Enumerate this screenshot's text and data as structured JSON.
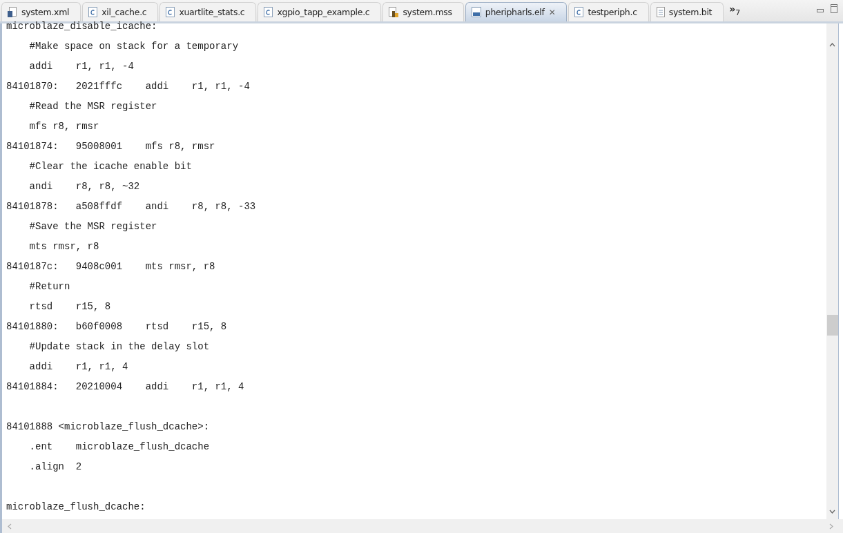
{
  "tabs": [
    {
      "label": "system.xml",
      "kind": "xml",
      "selected": false
    },
    {
      "label": "xil_cache.c",
      "kind": "c",
      "selected": false
    },
    {
      "label": "xuartlite_stats.c",
      "kind": "c",
      "selected": false
    },
    {
      "label": "xgpio_tapp_example.c",
      "kind": "c",
      "selected": false
    },
    {
      "label": "system.mss",
      "kind": "mss",
      "selected": false
    },
    {
      "label": "pheripharls.elf",
      "kind": "binary",
      "selected": true,
      "close": "✕"
    },
    {
      "label": "testperiph.c",
      "kind": "c",
      "selected": false
    },
    {
      "label": "system.bit",
      "kind": "file",
      "selected": false
    }
  ],
  "overflow": {
    "chevron": "»",
    "count": "7"
  },
  "code_blocks": [
    [
      "microblaze_disable_icache:",
      "    #Make space on stack for a temporary",
      "    addi    r1, r1, -4",
      "84101870:   2021fffc    addi    r1, r1, -4",
      "    #Read the MSR register",
      "    mfs r8, rmsr",
      "84101874:   95008001    mfs r8, rmsr",
      "    #Clear the icache enable bit",
      "    andi    r8, r8, ~32",
      "84101878:   a508ffdf    andi    r8, r8, -33",
      "    #Save the MSR register",
      "    mts rmsr, r8",
      "8410187c:   9408c001    mts rmsr, r8",
      "    #Return",
      "    rtsd    r15, 8",
      "84101880:   b60f0008    rtsd    r15, 8",
      "    #Update stack in the delay slot",
      "    addi    r1, r1, 4",
      "84101884:   20210004    addi    r1, r1, 4"
    ],
    [
      "84101888 <microblaze_flush_dcache>:",
      "    .ent    microblaze_flush_dcache",
      "    .align  2"
    ],
    [
      "microblaze_flush_dcache:"
    ]
  ]
}
